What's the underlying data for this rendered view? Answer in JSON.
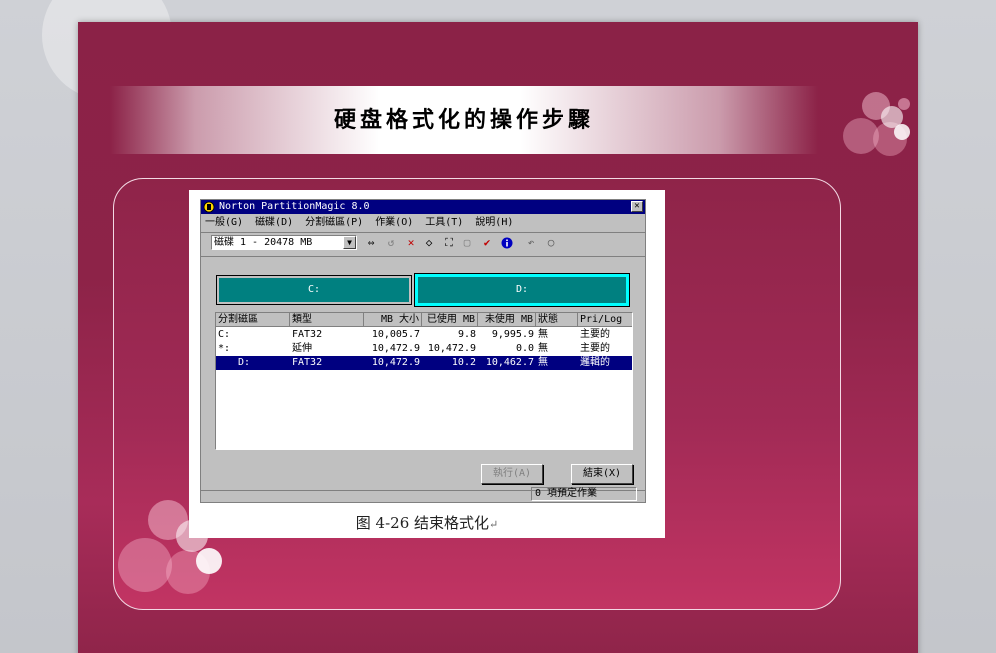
{
  "slide": {
    "title": "硬盘格式化的操作步驟",
    "caption": "图 4-26  结束格式化",
    "caption_mark": "↵"
  },
  "window": {
    "title": "Norton PartitionMagic 8.0",
    "close_label": "✕",
    "menu": [
      "一般(G)",
      "磁碟(D)",
      "分割磁區(P)",
      "作業(O)",
      "工具(T)",
      "說明(H)"
    ],
    "disk_select": "磁碟 1 - 20478  MB",
    "toolbar_icons": [
      "resize-icon",
      "undo-merge-icon",
      "delete-icon",
      "label-icon",
      "expand-icon",
      "copy-icon",
      "check-icon",
      "info-icon",
      "undo-icon",
      "redo-icon"
    ],
    "partitions_map": {
      "c_label": "C:",
      "d_label": "D:"
    },
    "table": {
      "headers": [
        "分割磁區",
        "類型",
        "MB 大小",
        "已使用 MB",
        "未使用 MB",
        "狀態",
        "Pri/Log"
      ],
      "rows": [
        [
          "C:",
          "FAT32",
          "10,005.7",
          "9.8",
          "9,995.9",
          "無",
          "主要的"
        ],
        [
          "*:",
          "延伸",
          "10,472.9",
          "10,472.9",
          "0.0",
          "無",
          "主要的"
        ],
        [
          "D:",
          "FAT32",
          "10,472.9",
          "10.2",
          "10,462.7",
          "無",
          "邏輯的"
        ]
      ],
      "selected_row": 2
    },
    "apply_button": "執行(A)",
    "exit_button": "結束(X)",
    "status": "0 項預定作業"
  },
  "colors": {
    "slide_bg": "#8b2247",
    "title_bar": "#000080",
    "partition_fill": "#008080",
    "partition_selected_border": "#00ffff",
    "selection": "#000080"
  }
}
